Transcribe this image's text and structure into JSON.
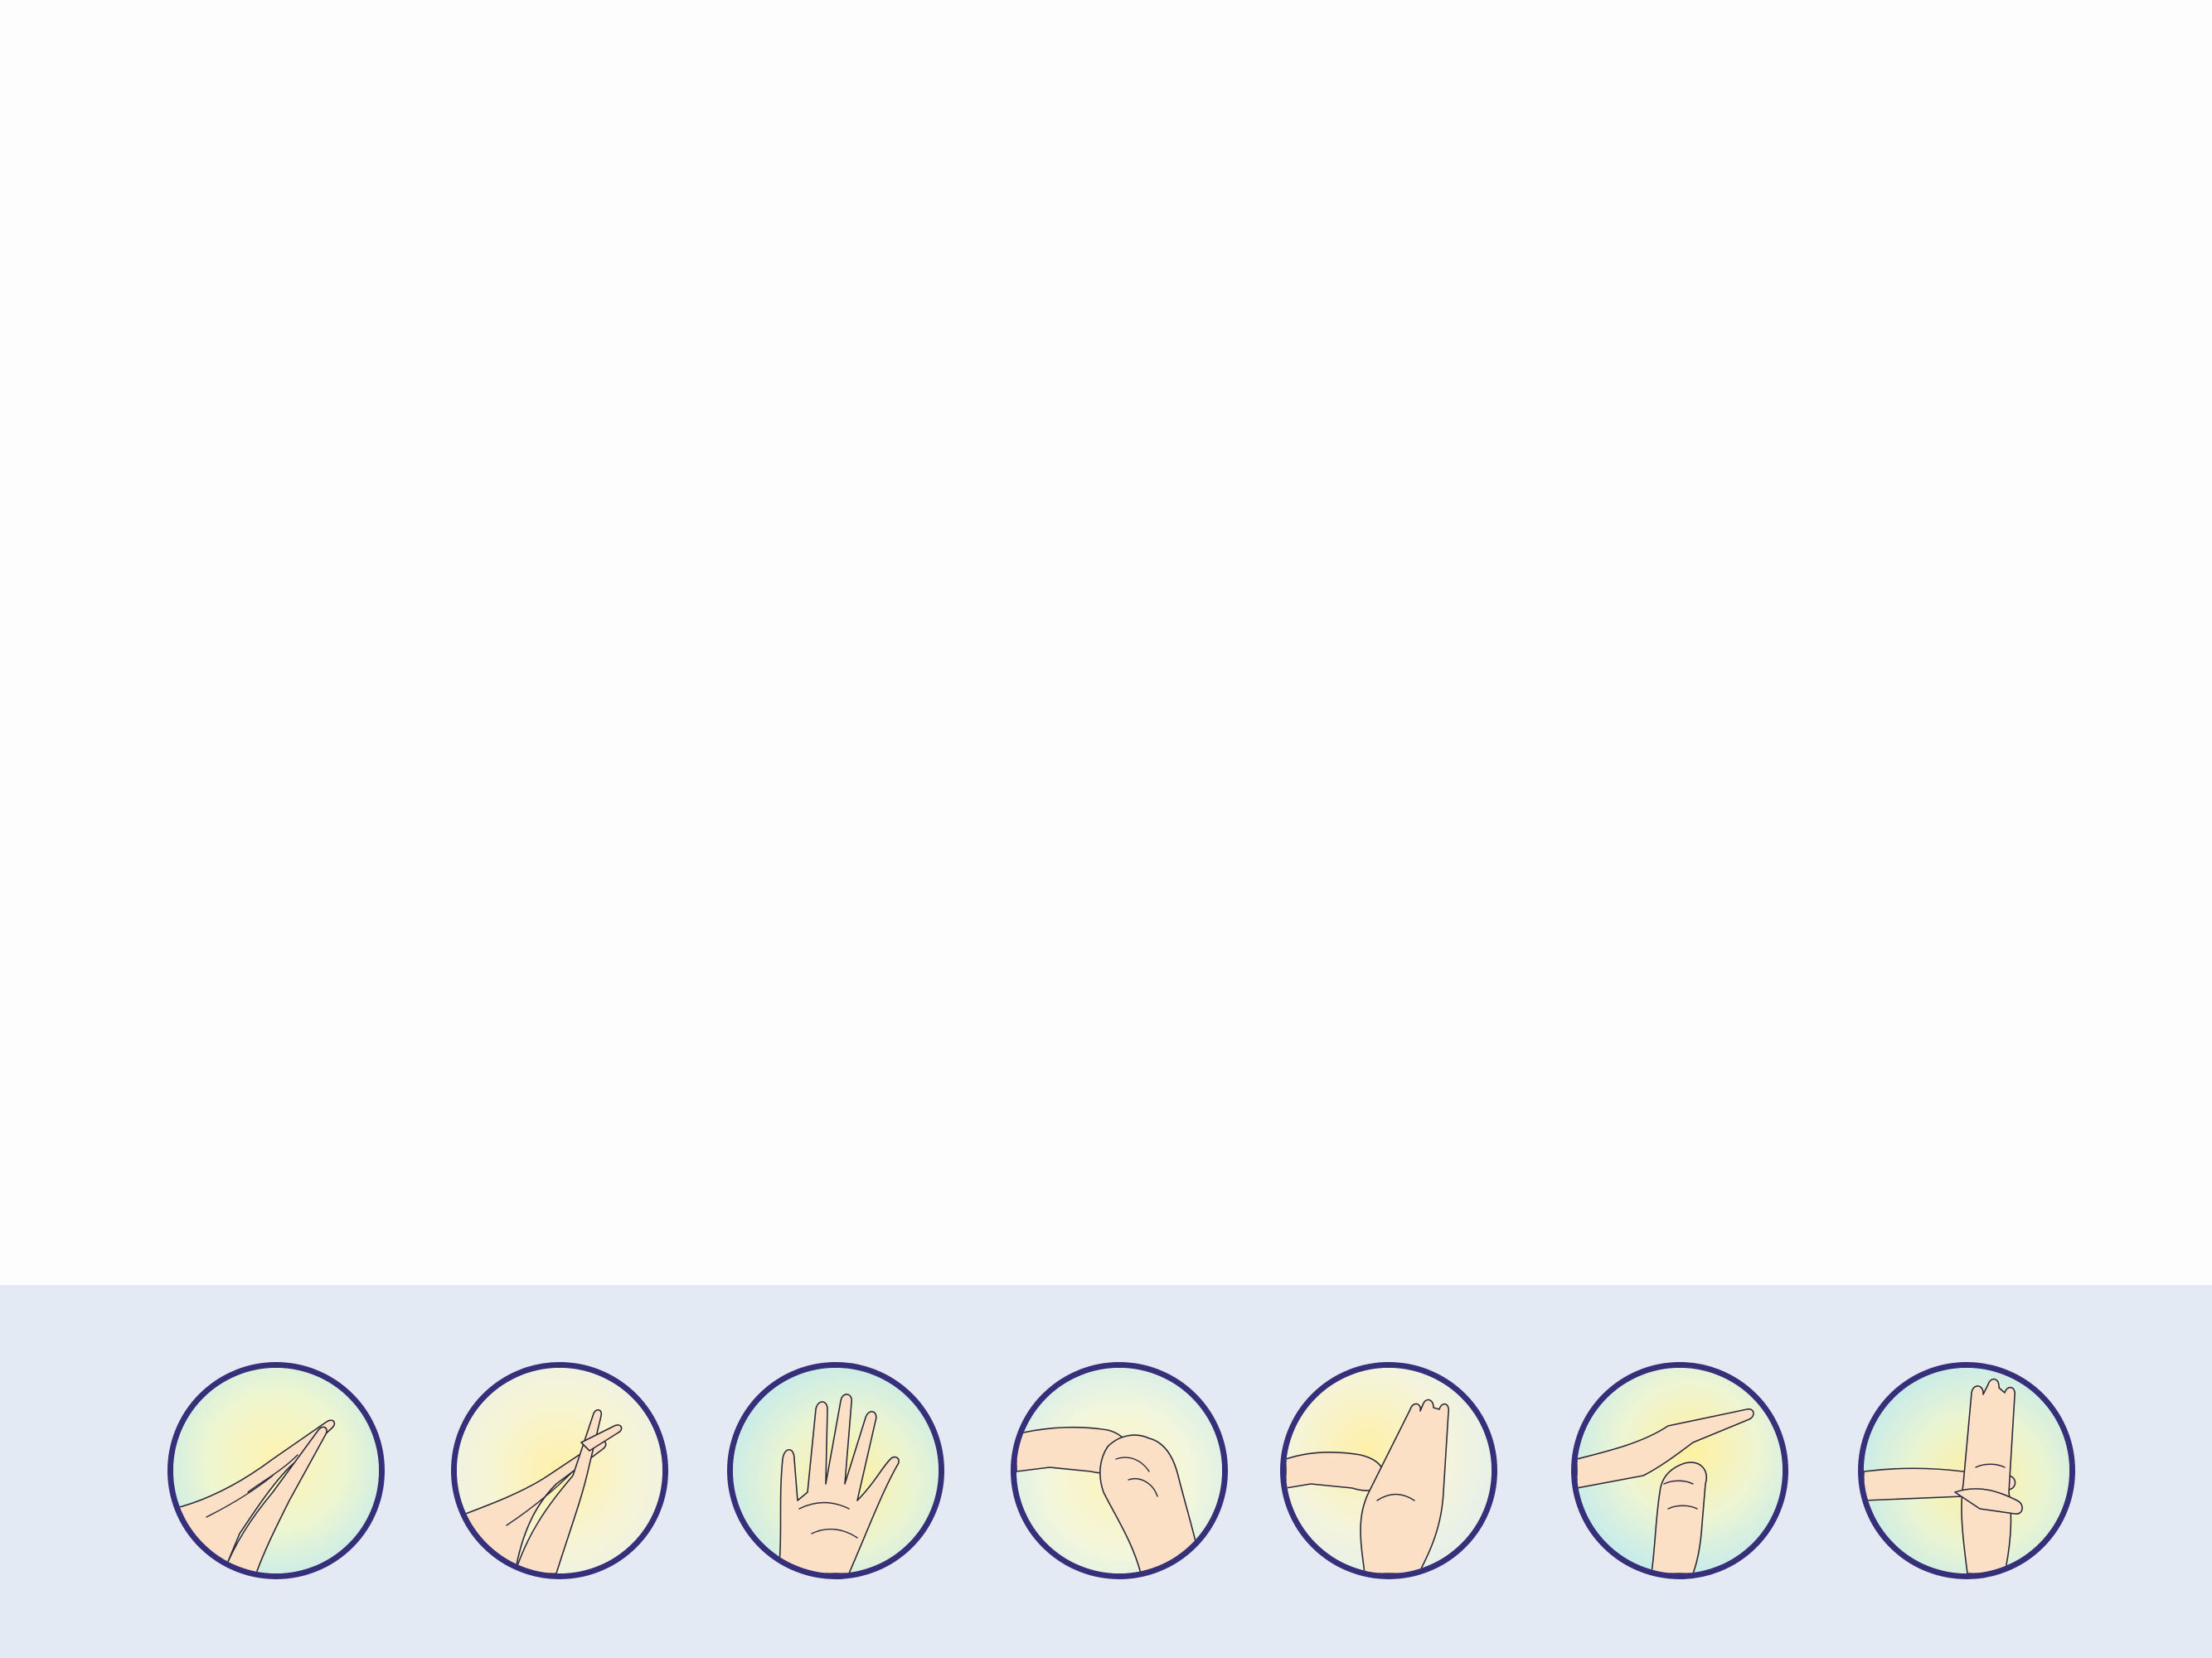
{
  "colors": {
    "background": "#fdfdfd",
    "band": "#e4eaf4",
    "circle_border": "#36307a",
    "skin": "#fbe0c6",
    "glow_yellow": "#fff3b0",
    "glow_aqua": "#c8ecea"
  },
  "steps": [
    {
      "icon": "palm-to-palm-rub-icon"
    },
    {
      "icon": "fingers-interlaced-rub-icon"
    },
    {
      "icon": "back-of-hand-rub-icon"
    },
    {
      "icon": "fingertips-clasp-rub-icon"
    },
    {
      "icon": "thumb-rotation-rub-icon"
    },
    {
      "icon": "fingertips-in-palm-rub-icon"
    },
    {
      "icon": "wrist-rub-icon"
    }
  ]
}
